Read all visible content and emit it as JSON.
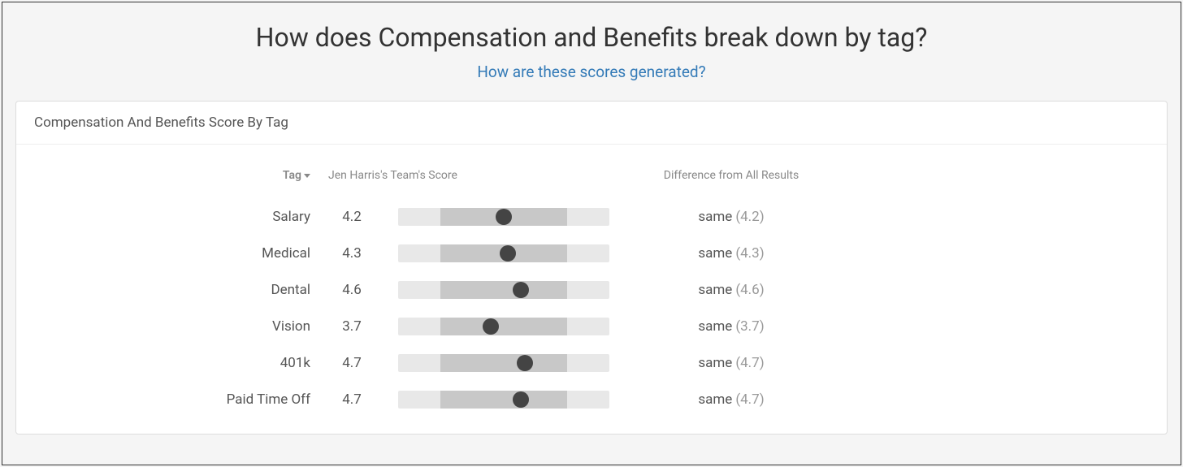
{
  "page": {
    "title": "How does Compensation and Benefits break down by tag?",
    "help_link": "How are these scores generated?"
  },
  "card": {
    "header": "Compensation And Benefits Score By Tag"
  },
  "columns": {
    "tag": "Tag",
    "score": "Jen Harris's Team's Score",
    "diff": "Difference from All Results"
  },
  "chart_data": {
    "type": "table",
    "title": "Compensation And Benefits Score By Tag",
    "xlabel": "Tag",
    "ylabel": "Jen Harris's Team's Score",
    "range": [
      0,
      10
    ],
    "band": [
      2,
      8
    ],
    "rows": [
      {
        "tag": "Salary",
        "score": "4.2",
        "diff_label": "same",
        "diff_value": "(4.2)",
        "pos": 50,
        "value": 4.2
      },
      {
        "tag": "Medical",
        "score": "4.3",
        "diff_label": "same",
        "diff_value": "(4.3)",
        "pos": 52,
        "value": 4.3
      },
      {
        "tag": "Dental",
        "score": "4.6",
        "diff_label": "same",
        "diff_value": "(4.6)",
        "pos": 58,
        "value": 4.6
      },
      {
        "tag": "Vision",
        "score": "3.7",
        "diff_label": "same",
        "diff_value": "(3.7)",
        "pos": 44,
        "value": 3.7
      },
      {
        "tag": "401k",
        "score": "4.7",
        "diff_label": "same",
        "diff_value": "(4.7)",
        "pos": 60,
        "value": 4.7
      },
      {
        "tag": "Paid Time Off",
        "score": "4.7",
        "diff_label": "same",
        "diff_value": "(4.7)",
        "pos": 58,
        "value": 4.7
      }
    ]
  }
}
